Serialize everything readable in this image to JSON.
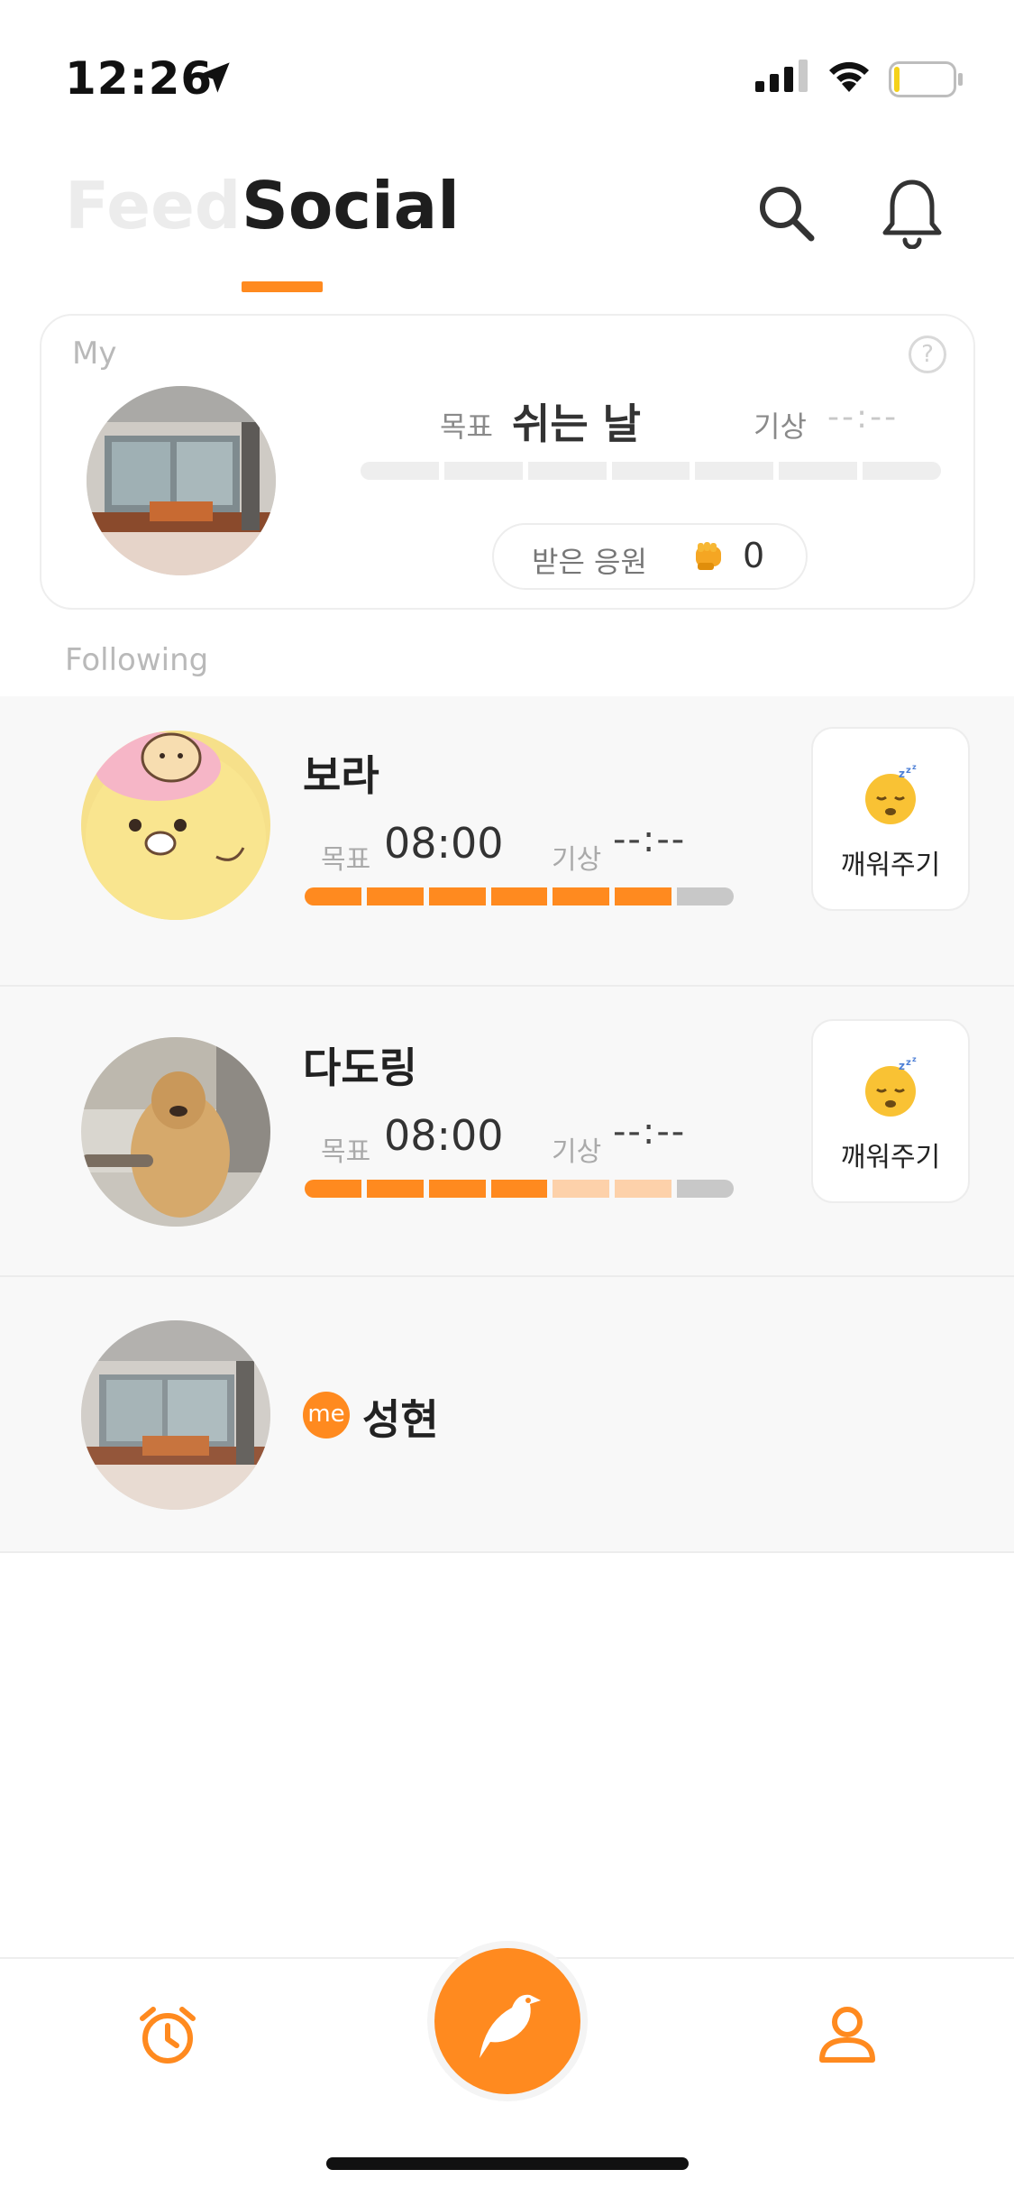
{
  "status_bar": {
    "time": "12:26"
  },
  "header": {
    "tabs": [
      {
        "label": "Feed",
        "active": false
      },
      {
        "label": "Social",
        "active": true
      }
    ]
  },
  "my_card": {
    "section_label": "My",
    "goal_label": "목표",
    "goal_value": "쉬는 날",
    "wake_label": "기상",
    "wake_value": "--:--",
    "cheer_label": "받은 응원",
    "cheer_count": "0"
  },
  "following_label": "Following",
  "following": [
    {
      "name": "보라",
      "goal_label": "목표",
      "goal_value": "08:00",
      "wake_label": "기상",
      "wake_value": "--:--",
      "wake_button_label": "깨워주기",
      "progress": [
        "on",
        "on",
        "on",
        "on",
        "on",
        "on",
        "off"
      ]
    },
    {
      "name": "다도링",
      "goal_label": "목표",
      "goal_value": "08:00",
      "wake_label": "기상",
      "wake_value": "--:--",
      "wake_button_label": "깨워주기",
      "progress": [
        "on",
        "on",
        "on",
        "on",
        "light",
        "light",
        "off"
      ]
    },
    {
      "name": "성현",
      "me_badge": "me"
    }
  ],
  "colors": {
    "accent": "#ff8a1f",
    "accent_light": "#fdd1aa",
    "inactive": "#c8c8c8",
    "row_bg": "#f8f8f8"
  },
  "icons": [
    "location-arrow-icon",
    "signal-icon",
    "wifi-icon",
    "battery-icon",
    "search-icon",
    "bell-icon",
    "help-icon",
    "fist-icon",
    "sleeping-face-icon",
    "alarm-clock-icon",
    "bird-icon",
    "profile-icon"
  ]
}
